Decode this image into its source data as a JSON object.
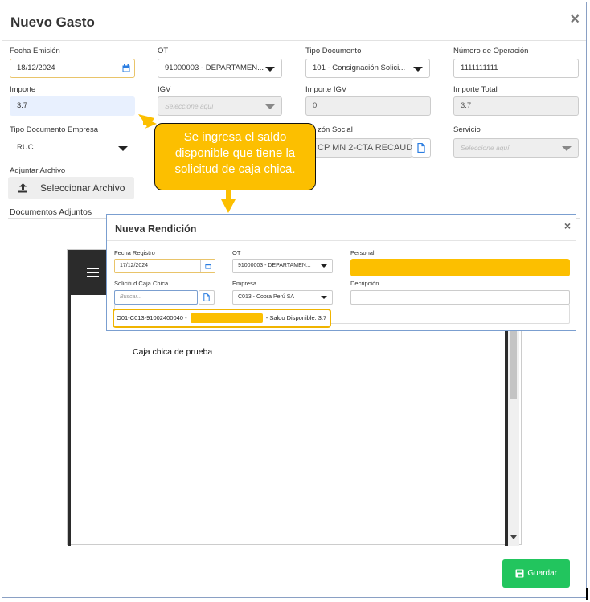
{
  "modal": {
    "title": "Nuevo Gasto",
    "close": "×"
  },
  "form": {
    "fecha_emision": {
      "label": "Fecha Emisión",
      "value": "18/12/2024"
    },
    "ot": {
      "label": "OT",
      "value": "91000003 - DEPARTAMEN..."
    },
    "tipo_documento": {
      "label": "Tipo Documento",
      "value": "101 - Consignación Solici..."
    },
    "numero_operacion": {
      "label": "Número de Operación",
      "value": "1111111111"
    },
    "importe": {
      "label": "Importe",
      "value": "3.7"
    },
    "igv": {
      "label": "IGV",
      "placeholder": "Seleccione aquí"
    },
    "importe_igv": {
      "label": "Importe IGV",
      "value": "0"
    },
    "importe_total": {
      "label": "Importe Total",
      "value": "3.7"
    },
    "tipo_documento_empresa": {
      "label": "Tipo Documento Empresa",
      "value": "RUC"
    },
    "razon_social": {
      "label": "zón Social",
      "value": "CP MN 2-CTA RECAUD"
    },
    "servicio": {
      "label": "Servicio",
      "placeholder": "Seleccione aquí"
    },
    "adjuntar_archivo": {
      "label": "Adjuntar Archivo",
      "button": "Seleccionar Archivo"
    },
    "documentos_adjuntos": {
      "label": "Documentos Adjuntos"
    }
  },
  "callout": {
    "text": "Se ingresa el saldo disponible que tiene la solicitud de caja chica."
  },
  "background_panel": {
    "text": "Caja chica de prueba"
  },
  "nueva_rendicion": {
    "title": "Nueva Rendición",
    "close": "×",
    "fecha_registro": {
      "label": "Fecha Registro",
      "value": "17/12/2024"
    },
    "ot": {
      "label": "OT",
      "value": "91000003 - DEPARTAMEN..."
    },
    "personal": {
      "label": "Personal"
    },
    "solicitud_caja_chica": {
      "label": "Solicitud Caja Chica",
      "placeholder": "Buscar..."
    },
    "empresa": {
      "label": "Empresa",
      "value": "C013 - Cobra Perú SA"
    },
    "descripcion": {
      "label": "Decripción"
    },
    "option": {
      "prefix": "O01-C013-91002400040 -",
      "suffix": "- Saldo Disponible: 3.7"
    }
  },
  "actions": {
    "save": "Guardar"
  },
  "colors": {
    "callout": "#fcbf00",
    "save": "#22c55e",
    "highlight": "#e8f0fe"
  }
}
